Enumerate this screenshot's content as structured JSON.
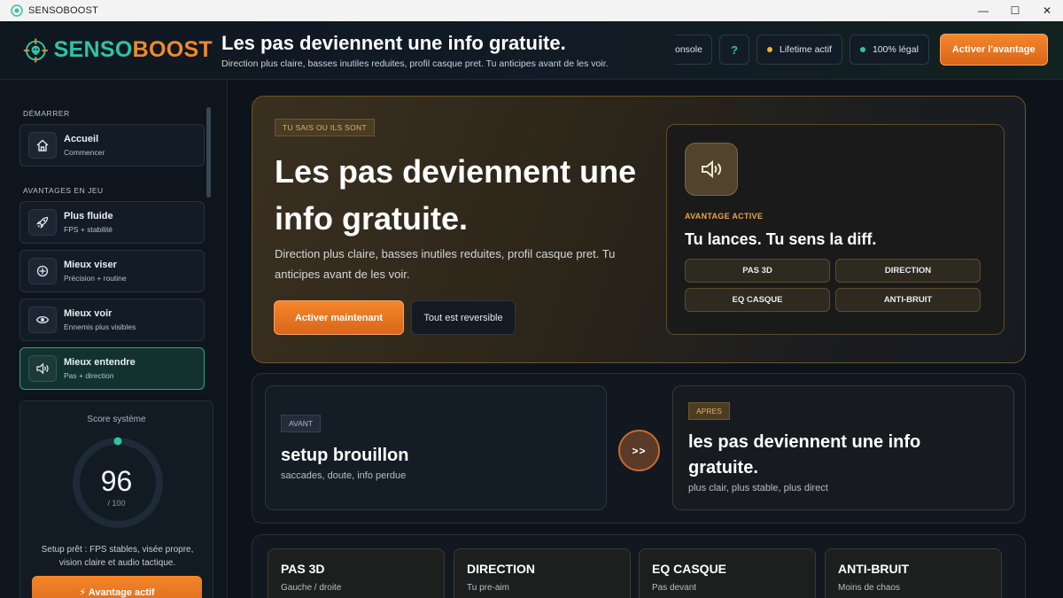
{
  "window": {
    "title": "SENSOBOOST",
    "controls": [
      "—",
      "☐",
      "✕"
    ]
  },
  "header": {
    "logo_part1": "SENSO",
    "logo_part2": "BOOST",
    "title": "Les pas deviennent une info gratuite.",
    "subtitle": "Direction plus claire, basses inutiles reduites, profil casque pret. Tu anticipes avant de les voir.",
    "console_label": "onsole",
    "help_label": "?",
    "lifetime_label": "Lifetime actif",
    "legal_label": "100% légal",
    "cta_label": "Activer l'avantage"
  },
  "sidebar": {
    "section_start": "DÉMARRER",
    "section_perks": "AVANTAGES EN JEU",
    "items": [
      {
        "title": "Accueil",
        "subtitle": "Commencer",
        "icon": "home-icon"
      },
      {
        "title": "Plus fluide",
        "subtitle": "FPS + stabilité",
        "icon": "rocket-icon"
      },
      {
        "title": "Mieux viser",
        "subtitle": "Précision + routine",
        "icon": "crosshair-icon"
      },
      {
        "title": "Mieux voir",
        "subtitle": "Ennemis plus visibles",
        "icon": "eye-icon"
      },
      {
        "title": "Mieux entendre",
        "subtitle": "Pas + direction",
        "icon": "speaker-icon"
      }
    ],
    "score": {
      "label": "Score système",
      "value": "96",
      "max": "/ 100",
      "description": "Setup prêt : FPS stables, visée propre, vision claire et audio tactique.",
      "button_label": "⚡ Avantage actif"
    }
  },
  "hero": {
    "tag": "TU SAIS OU ILS SONT",
    "title": "Les pas deviennent une info gratuite.",
    "description": "Direction plus claire, basses inutiles reduites, profil casque pret. Tu anticipes avant de les voir.",
    "primary_button": "Activer maintenant",
    "secondary_button": "Tout est reversible",
    "advantage": {
      "label": "AVANTAGE ACTIVE",
      "title": "Tu lances. Tu sens la diff.",
      "chips": [
        "PAS 3D",
        "DIRECTION",
        "EQ CASQUE",
        "ANTI-BRUIT"
      ]
    }
  },
  "comparison": {
    "before": {
      "tag": "AVANT",
      "title": "setup brouillon",
      "subtitle": "saccades, doute, info perdue"
    },
    "arrow": ">>",
    "after": {
      "tag": "APRES",
      "title": "les pas deviennent une info gratuite.",
      "subtitle": "plus clair, plus stable, plus direct"
    }
  },
  "features": [
    {
      "title": "PAS 3D",
      "subtitle": "Gauche / droite"
    },
    {
      "title": "DIRECTION",
      "subtitle": "Tu pre-aim"
    },
    {
      "title": "EQ CASQUE",
      "subtitle": "Pas devant"
    },
    {
      "title": "ANTI-BRUIT",
      "subtitle": "Moins de chaos"
    }
  ],
  "colors": {
    "accent_teal": "#2ec4a6",
    "accent_orange": "#f08a2a",
    "status_gold": "#e8b83a"
  }
}
